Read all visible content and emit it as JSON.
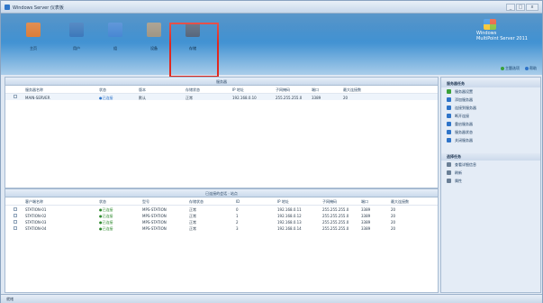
{
  "window": {
    "title": "Windows Server 仪表板",
    "controls": [
      "_",
      "□",
      "x"
    ]
  },
  "toolbar": {
    "buttons": [
      {
        "label": "主页",
        "icon": "home-icon",
        "color": "#d9742b"
      },
      {
        "label": "用户",
        "icon": "users-icon",
        "color": "#2f6fb6"
      },
      {
        "label": "组",
        "icon": "group-icon",
        "color": "#3b7fd0"
      },
      {
        "label": "设备",
        "icon": "devices-icon",
        "color": "#9a8f7c"
      },
      {
        "label": "存储",
        "icon": "storage-icon",
        "color": "#4b5c73"
      }
    ],
    "highlight_color": "#e0281f"
  },
  "brand": {
    "line1": "Windows",
    "line2": "MultiPoint Server 2011"
  },
  "header_links": [
    {
      "label": "主题选项",
      "icon": "green-dot-icon"
    },
    {
      "label": "帮助",
      "icon": "help-icon"
    }
  ],
  "top_pane": {
    "title": "服务器",
    "columns": [
      "服务器名称",
      "状态",
      "版本",
      "存储状态",
      "IP 地址",
      "子网掩码",
      "端口",
      "最大连接数"
    ],
    "rows": [
      [
        "MAIN-SERVER",
        "●已连接",
        "默认",
        "正常",
        "192.168.0.10",
        "255.255.255.0",
        "3389",
        "20"
      ]
    ]
  },
  "bottom_pane": {
    "title": "已连接的会话 · 站点",
    "columns": [
      "客户端名称",
      "状态",
      "型号",
      "存储状态",
      "ID",
      "IP 地址",
      "子网掩码",
      "端口",
      "最大连接数"
    ],
    "rows": [
      [
        "STATION-01",
        "●已连接",
        "MPS-STATION",
        "正常",
        "0",
        "192.168.0.11",
        "255.255.255.0",
        "3389",
        "20"
      ],
      [
        "STATION-02",
        "●已连接",
        "MPS-STATION",
        "正常",
        "1",
        "192.168.0.12",
        "255.255.255.0",
        "3389",
        "20"
      ],
      [
        "STATION-03",
        "●已连接",
        "MPS-STATION",
        "正常",
        "2",
        "192.168.0.13",
        "255.255.255.0",
        "3389",
        "20"
      ],
      [
        "STATION-04",
        "●已连接",
        "MPS-STATION",
        "正常",
        "3",
        "192.168.0.14",
        "255.255.255.0",
        "3389",
        "20"
      ]
    ]
  },
  "sidebar": {
    "section1_title": "服务器任务",
    "section1_items": [
      {
        "label": "服务器设置",
        "icon": "settings-icon",
        "color": "#3aa13a"
      },
      {
        "label": "添加服务器",
        "icon": "add-icon",
        "color": "#2e74c9"
      },
      {
        "label": "连接到服务器",
        "icon": "connect-icon",
        "color": "#2e74c9"
      },
      {
        "label": "断开连接",
        "icon": "disconnect-icon",
        "color": "#2e74c9"
      },
      {
        "label": "重启服务器",
        "icon": "restart-icon",
        "color": "#2e74c9"
      },
      {
        "label": "服务器状态",
        "icon": "status-icon",
        "color": "#2e74c9"
      },
      {
        "label": "关闭服务器",
        "icon": "shutdown-icon",
        "color": "#2e74c9"
      }
    ],
    "section2_title": "选择任务",
    "section2_items": [
      {
        "label": "查看详细信息",
        "icon": "view-icon",
        "color": "#6a7f96"
      },
      {
        "label": "刷新",
        "icon": "refresh-icon",
        "color": "#6a7f96"
      },
      {
        "label": "属性",
        "icon": "properties-icon",
        "color": "#6a7f96"
      }
    ]
  },
  "statusbar": {
    "text": "就绪"
  }
}
